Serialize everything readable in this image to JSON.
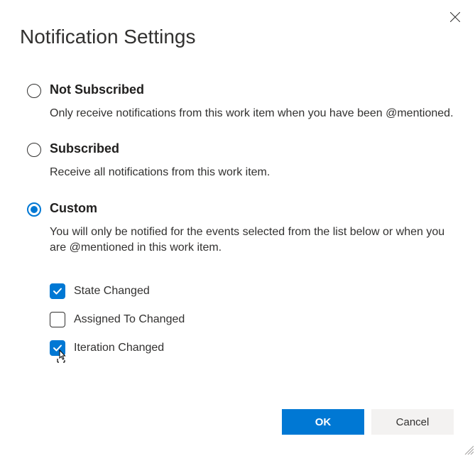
{
  "title": "Notification Settings",
  "options": {
    "not_subscribed": {
      "label": "Not Subscribed",
      "desc": "Only receive notifications from this work item when you have been @mentioned."
    },
    "subscribed": {
      "label": "Subscribed",
      "desc": "Receive all notifications from this work item."
    },
    "custom": {
      "label": "Custom",
      "desc": "You will only be notified for the events selected from the list below or when you are @mentioned in this work item."
    }
  },
  "sub_options": {
    "state_changed": "State Changed",
    "assigned_to_changed": "Assigned To Changed",
    "iteration_changed": "Iteration Changed"
  },
  "buttons": {
    "ok": "OK",
    "cancel": "Cancel"
  },
  "selected_option": "custom",
  "checked": {
    "state_changed": true,
    "assigned_to_changed": false,
    "iteration_changed": true
  }
}
